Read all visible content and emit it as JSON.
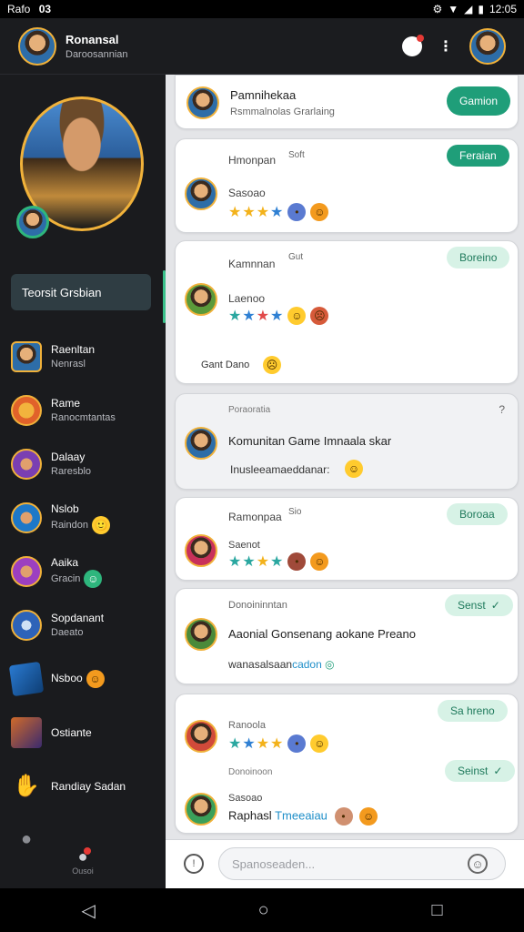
{
  "status_bar": {
    "left": "Rafo",
    "left_icon": "03",
    "time": "12:05"
  },
  "app_bar": {
    "title": "Ronansal",
    "subtitle": "Daroosannian",
    "bell_icon": "bell-icon",
    "menu_icon": "more-vert-icon"
  },
  "sidebar": {
    "profile_label": "Teorsit Grsbian",
    "items": [
      {
        "label": "Raenltan",
        "sub": "Nenrasl",
        "emoji": ""
      },
      {
        "label": "Rame",
        "sub": "Ranocmtantas",
        "emoji": ""
      },
      {
        "label": "Dalaay",
        "sub": "Raresblo",
        "emoji": ""
      },
      {
        "label": "Nslob",
        "sub": "Raindon",
        "emoji": "🙂"
      },
      {
        "label": "Aaika",
        "sub": "Gracin",
        "emoji": "☺"
      },
      {
        "label": "Sopdanant",
        "sub": "Daeato",
        "emoji": ""
      },
      {
        "label": "Nsboo",
        "sub": "",
        "emoji": "☺"
      },
      {
        "label": "Ostiante",
        "sub": "",
        "emoji": ""
      },
      {
        "label": "Randiay Sadan",
        "sub": "",
        "emoji": ""
      },
      {
        "label": "",
        "sub": "",
        "emoji": ""
      }
    ],
    "footer_label": "Ousoi"
  },
  "feed": [
    {
      "name": "Pamnihekaa",
      "sub": "Rsmmalnolas Grarlaing",
      "button": "Gamion"
    },
    {
      "name": "Hmonpan",
      "time": "Soft",
      "text": "Sasoao",
      "badge": "Feraian"
    },
    {
      "name": "Kamnnan",
      "time": "Gut",
      "text": "Laenoo",
      "footer": "Gant Dano",
      "badge": "Boreino"
    },
    {
      "name": "Poraoratia",
      "text": "Komunitan Game Imnaala skar",
      "sub": "Inusleeamaeddanar:"
    },
    {
      "name": "Ramonpaa",
      "time": "Sio",
      "text": "Saenot",
      "badge": "Boroaa"
    },
    {
      "name": "Donoininntan",
      "text": "Aaonial Gonsenang aokane Preano",
      "sub": "wanasalsaan",
      "link": "cadon",
      "badge": "Senst"
    },
    {
      "name": "Ranoola",
      "text": "Donoinoon",
      "foot_name": "Sasoao",
      "foot_text": "Raphasl",
      "foot_link": "Tmeeaiau",
      "badge1": "Sa hreno",
      "badge2": "Seinst"
    }
  ],
  "composer": {
    "placeholder": "Spanoseaden..."
  },
  "colors": {
    "accent": "#1f9e79",
    "accent_light": "#d7f2e6",
    "sidebar": "#1a1b1e",
    "feed_bg": "#e4e5e8"
  }
}
